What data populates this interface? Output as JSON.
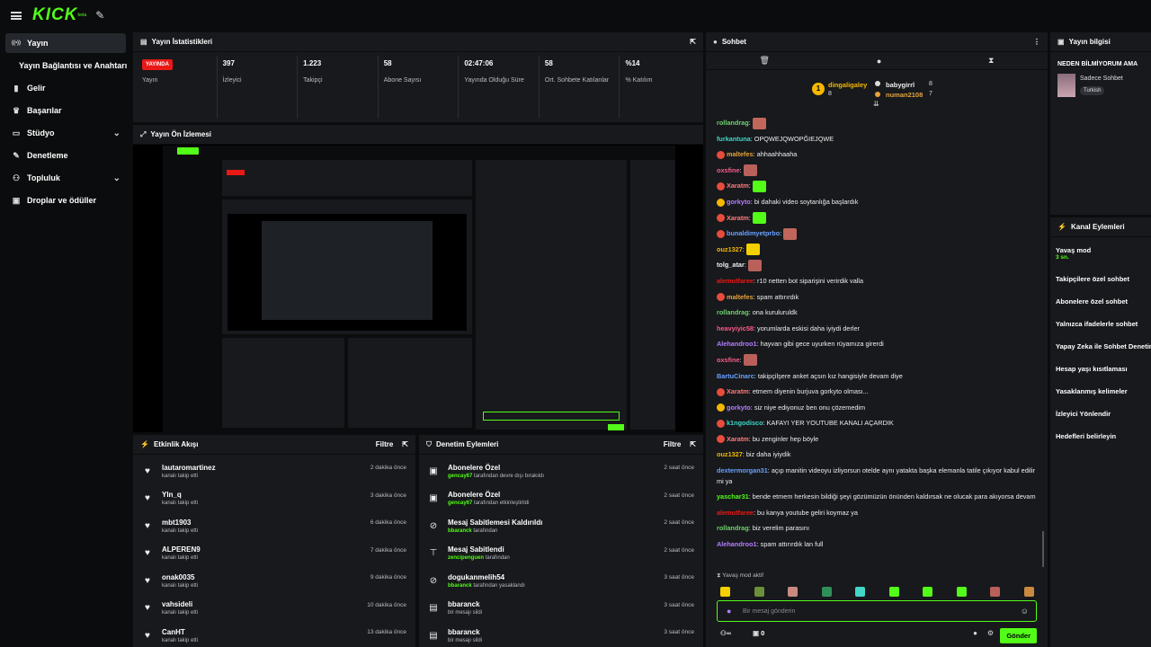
{
  "app": {
    "logo": "KICK",
    "logo_sup": "beta"
  },
  "sidebar": {
    "items": [
      {
        "label": "Yayın",
        "icon": "broadcast-icon",
        "active": true
      },
      {
        "label": "Yayın Bağlantısı ve Anahtarı",
        "sub": true
      },
      {
        "label": "Gelir",
        "icon": "chart-icon"
      },
      {
        "label": "Başarılar",
        "icon": "trophy-icon"
      },
      {
        "label": "Stüdyo",
        "icon": "monitor-icon",
        "chevron": true
      },
      {
        "label": "Denetleme",
        "icon": "wrench-icon"
      },
      {
        "label": "Topluluk",
        "icon": "users-icon",
        "chevron": true
      },
      {
        "label": "Droplar ve ödüller",
        "icon": "gift-icon"
      }
    ]
  },
  "stats_panel": {
    "title": "Yayın İstatistikleri",
    "live_badge": "YAYINDA",
    "live_label": "Yayın",
    "stats": [
      {
        "value": "397",
        "label": "İzleyici"
      },
      {
        "value": "1.223",
        "label": "Takipçi"
      },
      {
        "value": "58",
        "label": "Abone Sayısı"
      },
      {
        "value": "02:47:06",
        "label": "Yayında Olduğu Süre"
      },
      {
        "value": "58",
        "label": "Ort. Sohbete Katılanlar"
      },
      {
        "value": "%14",
        "label": "% Katılım"
      }
    ]
  },
  "preview_panel": {
    "title": "Yayın Ön İzlemesi"
  },
  "activity_panel": {
    "title": "Etkinlik Akışı",
    "filter": "Filtre",
    "items": [
      {
        "name": "lautaromartinez",
        "detail": "kanalı takip etti",
        "time": "2 dakika önce"
      },
      {
        "name": "Yln_q",
        "detail": "kanalı takip etti",
        "time": "3 dakika önce"
      },
      {
        "name": "mbt1903",
        "detail": "kanalı takip etti",
        "time": "6 dakika önce"
      },
      {
        "name": "ALPEREN9",
        "detail": "kanalı takip etti",
        "time": "7 dakika önce"
      },
      {
        "name": "onak0035",
        "detail": "kanalı takip etti",
        "time": "9 dakika önce"
      },
      {
        "name": "vahsideli",
        "detail": "kanalı takip etti",
        "time": "10 dakika önce"
      },
      {
        "name": "CanHT",
        "detail": "kanalı takip etti",
        "time": "13 dakika önce"
      }
    ]
  },
  "moderation_panel": {
    "title": "Denetim Eylemleri",
    "filter": "Filtre",
    "items": [
      {
        "icon": "gift-icon",
        "title": "Abonelere Özel",
        "user": "gencay67",
        "detail": "tarafından devre dışı bırakıldı",
        "time": "2 saat önce"
      },
      {
        "icon": "gift-icon",
        "title": "Abonelere Özel",
        "user": "gencay67",
        "detail": "tarafından etkinleştirildi",
        "time": "2 saat önce"
      },
      {
        "icon": "unpin-icon",
        "title": "Mesaj Sabitlemesi Kaldırıldı",
        "user": "bbaranck",
        "detail": "tarafından",
        "time": "2 saat önce"
      },
      {
        "icon": "pin-icon",
        "title": "Mesaj Sabitlendi",
        "user": "zencipenguen",
        "detail": "tarafından",
        "time": "2 saat önce"
      },
      {
        "icon": "ban-icon",
        "title": "dogukanmelih54",
        "user": "bbaranck",
        "detail": "tarafından yasaklandı",
        "time": "3 saat önce"
      },
      {
        "icon": "trash-icon",
        "title": "bbaranck",
        "user": "",
        "detail": "bir mesajı sildi",
        "time": "3 saat önce"
      },
      {
        "icon": "trash-icon",
        "title": "bbaranck",
        "user": "",
        "detail": "bir mesajı sildi",
        "time": "3 saat önce"
      }
    ]
  },
  "chat_panel": {
    "title": "Sohbet",
    "gifters": [
      {
        "name": "dingaligaley",
        "count": "8",
        "rank": "1"
      },
      {
        "name": "babygirrl",
        "count": "8"
      },
      {
        "name": "numan2108",
        "count": "7"
      }
    ],
    "messages": [
      {
        "user": "rollandrag",
        "color": "#6fd06f",
        "text": "",
        "emote": "#c0665a"
      },
      {
        "user": "furkantuna",
        "color": "#41d6c6",
        "text": "OPQWEJQWOPĞIEJQWE"
      },
      {
        "user": "maltefes",
        "color": "#e6a23c",
        "text": "ahhaahhaaha",
        "badge": "#e74c3c"
      },
      {
        "user": "oxsfine",
        "color": "#ff5a8a",
        "text": "",
        "emote": "#b9605a"
      },
      {
        "user": "Xaratm",
        "color": "#ff7b7b",
        "text": "",
        "badge": "#e74c3c",
        "emote": "#53fc18"
      },
      {
        "user": "gorkyto",
        "color": "#b57cff",
        "text": "bi dahaki video soytanlığa başlardık",
        "badge": "#f5b700"
      },
      {
        "user": "Xaratm",
        "color": "#ff7b7b",
        "text": "",
        "badge": "#e74c3c",
        "emote": "#53fc18"
      },
      {
        "user": "bunaldimyetprbo",
        "color": "#6aa0ff",
        "text": "",
        "badge": "#e74c3c",
        "emote": "#c0665a"
      },
      {
        "user": "ouz1327",
        "color": "#f5b700",
        "text": "",
        "emote": "#f5d000"
      },
      {
        "user": "tolg_atar",
        "color": "#eee",
        "text": "",
        "emote": "#b9605a"
      },
      {
        "user": "alemutfaree",
        "color": "#e91916",
        "text": "r10 netten bot siparişini verirdik valla"
      },
      {
        "user": "maltefes",
        "color": "#e6a23c",
        "text": "spam attırırdık",
        "badge": "#e74c3c"
      },
      {
        "user": "rollandrag",
        "color": "#6fd06f",
        "text": "ona kuruluruldk"
      },
      {
        "user": "heavyiyic58",
        "color": "#ff5a8a",
        "text": "yorumlarda eskisi daha iyiydi derler"
      },
      {
        "user": "Alehandroo1",
        "color": "#b57cff",
        "text": "hayvan gibi gece uyurken rüyamıza girerdi"
      },
      {
        "user": "oxsfine",
        "color": "#ff5a8a",
        "text": "",
        "emote": "#b9605a"
      },
      {
        "user": "BartuCinarc",
        "color": "#6aa0ff",
        "text": "takipçilşere anket açsın kız hangisiyle devam diye"
      },
      {
        "user": "Xaratm",
        "color": "#ff7b7b",
        "text": "etmem diyenin burjuva gorkyto olması...",
        "badge": "#e74c3c"
      },
      {
        "user": "gorkyto",
        "color": "#b57cff",
        "text": "siz niye ediyonuz ben onu çözemedim",
        "badge": "#f5b700"
      },
      {
        "user": "k1ngodisco",
        "color": "#41d6c6",
        "text": "KAFAYI YER YOUTUBE KANALI AÇARDIK",
        "badge": "#e74c3c"
      },
      {
        "user": "Xaratm",
        "color": "#ff7b7b",
        "text": "bu zenginler hep böyle",
        "badge": "#e74c3c"
      },
      {
        "user": "ouz1327",
        "color": "#f5b700",
        "text": "biz daha iyiydik"
      },
      {
        "user": "dextermorgan31",
        "color": "#6aa0ff",
        "text": "açıp manitin videoyu izliyorsun otelde aynı yatakta başka elemanla tatile çıkıyor kabul edilir mi ya",
        "wrap": true
      },
      {
        "user": "yaschar31",
        "color": "#53fc18",
        "text": "bende etmem herkesin bildiği şeyi gözümüzün önünden kaldırsak ne olucak para akıyorsa devam",
        "wrap": true
      },
      {
        "user": "alemutfaree",
        "color": "#e91916",
        "text": "bu kanya youtube geliri koymaz ya"
      },
      {
        "user": "rollandrag",
        "color": "#6fd06f",
        "text": "biz verelim parasını"
      },
      {
        "user": "Alehandroo1",
        "color": "#b57cff",
        "text": "spam attırırdık lan full"
      }
    ],
    "slow_mode_label": "Yavaş mod aktif",
    "input_placeholder": "Bir mesaj gönderin",
    "send_label": "Gönder",
    "counter": "0",
    "gift_counter": "0"
  },
  "info_panel": {
    "title": "Yayın bilgisi",
    "stream_title": "NEDEN BİLMİYORUM AMA",
    "category": "Sadece Sohbet",
    "tag": "Turkish"
  },
  "channel_actions": {
    "title": "Kanal Eylemleri",
    "items": [
      {
        "label": "Yavaş mod",
        "sub": "3 sn."
      },
      {
        "label": "Takipçilere özel sohbet"
      },
      {
        "label": "Abonelere özel sohbet"
      },
      {
        "label": "Yalnızca ifadelerle sohbet"
      },
      {
        "label": "Yapay Zeka ile Sohbet Denetimi"
      },
      {
        "label": "Hesap yaşı kısıtlaması"
      },
      {
        "label": "Yasaklanmış kelimeler"
      },
      {
        "label": "İzleyici Yönlendir"
      },
      {
        "label": "Hedefleri belirleyin"
      }
    ]
  },
  "colors": {
    "accent": "#53fc18",
    "live": "#e91916",
    "panel": "#17191c",
    "bg": "#0b0c0d"
  }
}
